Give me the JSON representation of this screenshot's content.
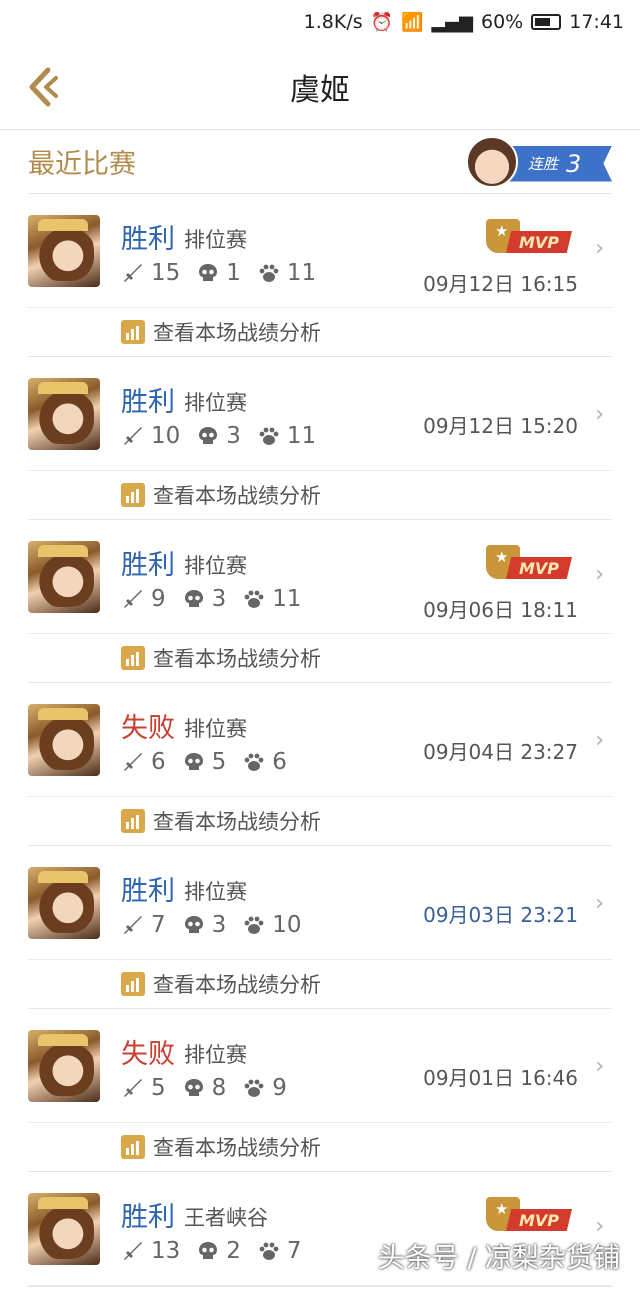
{
  "status_bar": {
    "speed": "1.8K/s",
    "battery": "60%",
    "time": "17:41"
  },
  "header": {
    "title": "虞姬"
  },
  "section": {
    "title": "最近比赛",
    "streak_label": "连胜",
    "streak_count": "3"
  },
  "analysis_label": "查看本场战绩分析",
  "mvp_label": "MVP",
  "matches": [
    {
      "result": "胜利",
      "mode": "排位赛",
      "kills": "15",
      "deaths": "1",
      "assists": "11",
      "time": "09月12日 16:15",
      "mvp": true
    },
    {
      "result": "胜利",
      "mode": "排位赛",
      "kills": "10",
      "deaths": "3",
      "assists": "11",
      "time": "09月12日 15:20",
      "mvp": false
    },
    {
      "result": "胜利",
      "mode": "排位赛",
      "kills": "9",
      "deaths": "3",
      "assists": "11",
      "time": "09月06日 18:11",
      "mvp": true
    },
    {
      "result": "失败",
      "mode": "排位赛",
      "kills": "6",
      "deaths": "5",
      "assists": "6",
      "time": "09月04日 23:27",
      "mvp": false
    },
    {
      "result": "胜利",
      "mode": "排位赛",
      "kills": "7",
      "deaths": "3",
      "assists": "10",
      "time": "09月03日 23:21",
      "mvp": false
    },
    {
      "result": "失败",
      "mode": "排位赛",
      "kills": "5",
      "deaths": "8",
      "assists": "9",
      "time": "09月01日 16:46",
      "mvp": false
    },
    {
      "result": "胜利",
      "mode": "王者峡谷",
      "kills": "13",
      "deaths": "2",
      "assists": "7",
      "time": "",
      "mvp": true
    }
  ],
  "watermark": "头条号 / 凉梨杂货铺",
  "colors": {
    "win": "#2f64b0",
    "lose": "#c8402f",
    "gold": "#b08d4e",
    "accent_blue": "#3d72c8"
  },
  "icons": {
    "back": "back-chevron-icon",
    "kill": "sword-icon",
    "death": "skull-icon",
    "assist": "paw-icon",
    "analysis": "bar-chart-icon",
    "chevron": "chevron-right-icon"
  }
}
